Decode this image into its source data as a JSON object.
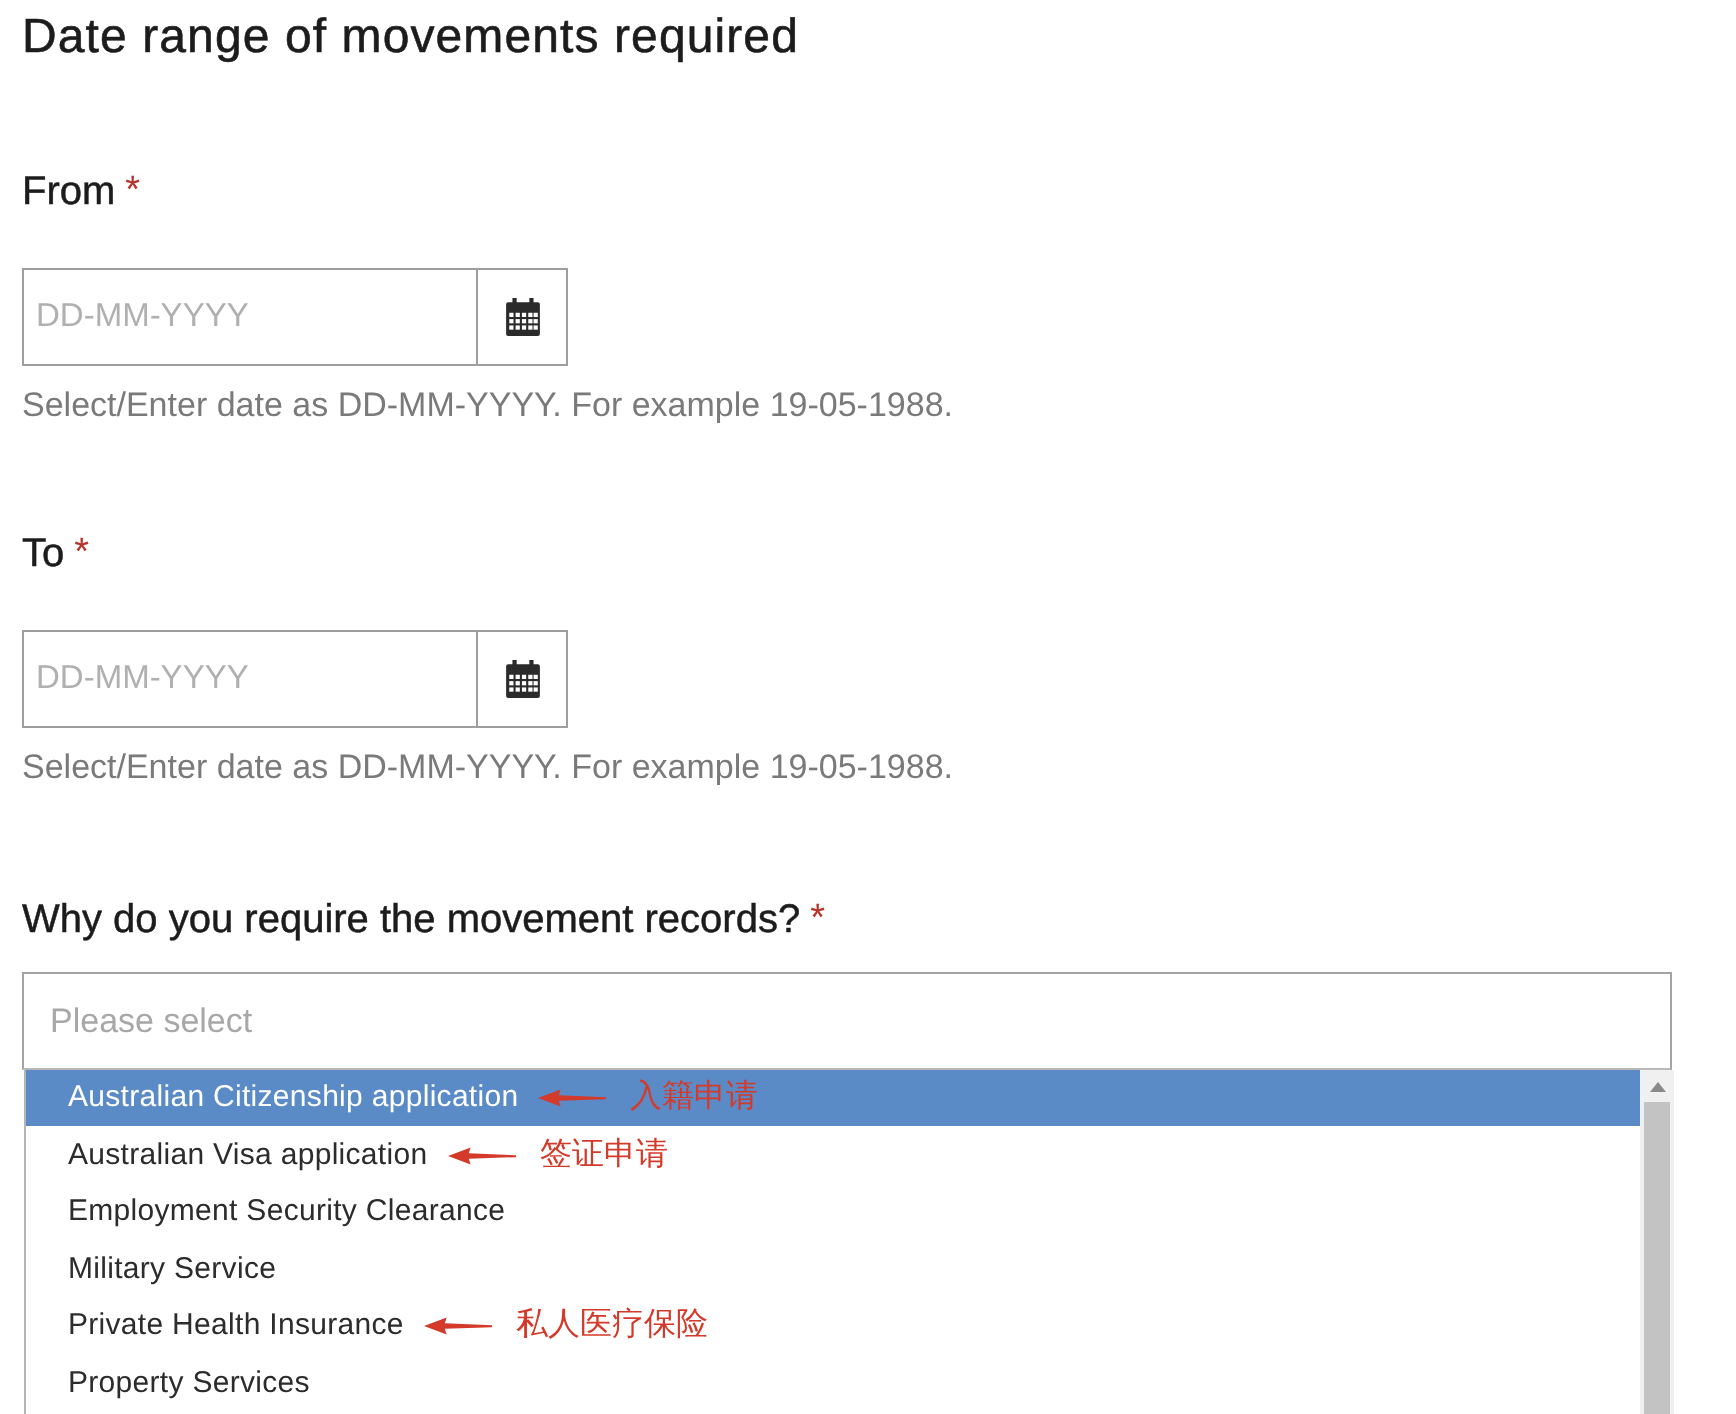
{
  "heading": "Date range of movements required",
  "date_fields": [
    {
      "label": "From",
      "required_mark": "*",
      "placeholder": "DD-MM-YYYY",
      "help": "Select/Enter date as DD-MM-YYYY. For example 19-05-1988."
    },
    {
      "label": "To",
      "required_mark": "*",
      "placeholder": "DD-MM-YYYY",
      "help": "Select/Enter date as DD-MM-YYYY. For example 19-05-1988."
    }
  ],
  "reason_select": {
    "label": "Why do you require the movement records?",
    "required_mark": "*",
    "placeholder": "Please select",
    "expanded": true,
    "options": [
      {
        "label": "Australian Citizenship application",
        "selected": true,
        "annotation": "入籍申请"
      },
      {
        "label": "Australian Visa application",
        "selected": false,
        "annotation": "签证申请"
      },
      {
        "label": "Employment Security Clearance",
        "selected": false
      },
      {
        "label": "Military Service",
        "selected": false
      },
      {
        "label": "Private Health Insurance",
        "selected": false,
        "annotation": "私人医疗保险"
      },
      {
        "label": "Property Services",
        "selected": false
      }
    ]
  }
}
